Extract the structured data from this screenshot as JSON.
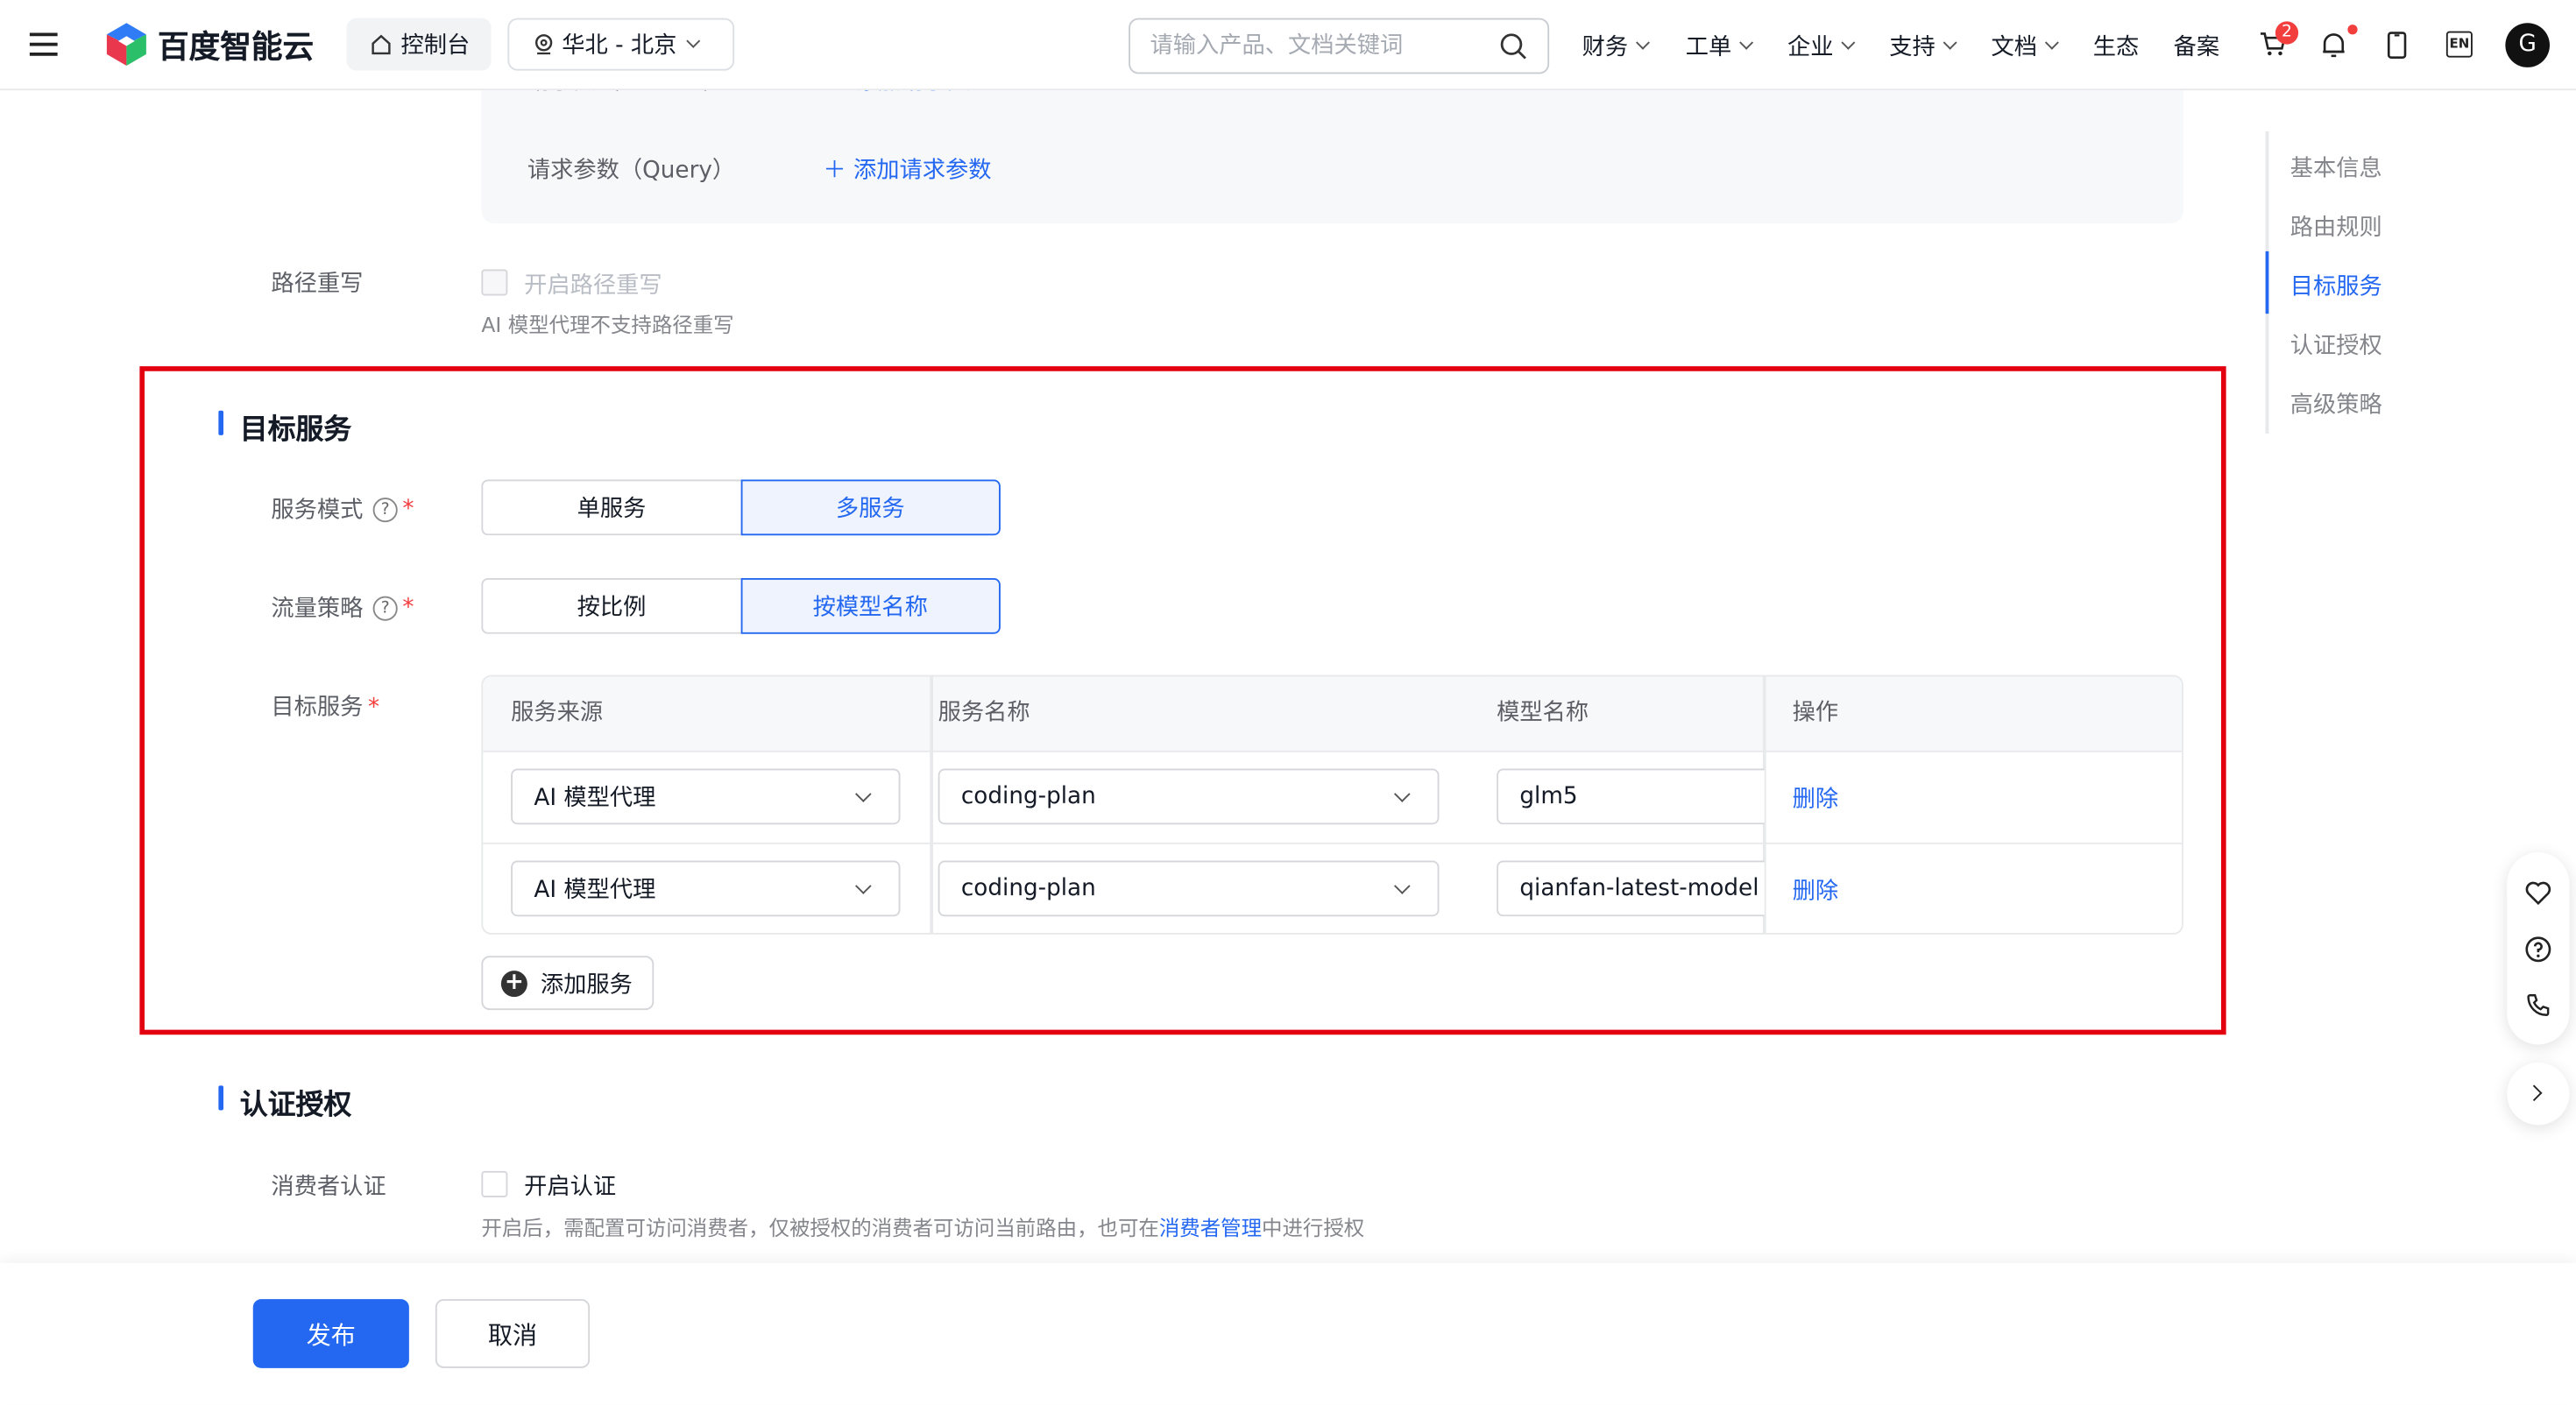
{
  "header": {
    "logo_text": "百度智能云",
    "console_label": "控制台",
    "region_label": "华北 - 北京",
    "search_placeholder": "请输入产品、文档关键词",
    "nav": [
      "财务",
      "工单",
      "企业",
      "支持",
      "文档",
      "生态",
      "备案"
    ],
    "cart_badge": "2",
    "lang_label": "EN",
    "avatar_letter": "G"
  },
  "request": {
    "header_label_clipped": "请求头（Header）",
    "header_add_clipped": "添加请求头",
    "query_label": "请求参数（Query）",
    "query_add": "添加请求参数"
  },
  "rewrite": {
    "label": "路径重写",
    "checkbox_label": "开启路径重写",
    "hint": "AI 模型代理不支持路径重写"
  },
  "target_section": {
    "title": "目标服务",
    "mode_label": "服务模式",
    "mode_options": [
      "单服务",
      "多服务"
    ],
    "mode_selected": "多服务",
    "strategy_label": "流量策略",
    "strategy_options": [
      "按比例",
      "按模型名称"
    ],
    "strategy_selected": "按模型名称",
    "target_label": "目标服务",
    "table": {
      "columns": [
        "服务来源",
        "服务名称",
        "模型名称",
        "操作"
      ],
      "rows": [
        {
          "source": "AI 模型代理",
          "service": "coding-plan",
          "model": "glm5",
          "action": "删除"
        },
        {
          "source": "AI 模型代理",
          "service": "coding-plan",
          "model": "qianfan-latest-model",
          "action": "删除"
        }
      ]
    },
    "add_button": "添加服务"
  },
  "auth_section": {
    "title": "认证授权",
    "consumer_label": "消费者认证",
    "checkbox_label": "开启认证",
    "hint_prefix": "开启后，需配置可访问消费者，仅被授权的消费者可访问当前路由，也可在",
    "hint_link": "消费者管理",
    "hint_suffix": "中进行授权"
  },
  "side_nav": {
    "items": [
      "基本信息",
      "路由规则",
      "目标服务",
      "认证授权",
      "高级策略"
    ],
    "active": "目标服务"
  },
  "footer": {
    "publish": "发布",
    "cancel": "取消"
  },
  "colors": {
    "primary": "#2468f2",
    "highlight_box": "#e3000f"
  }
}
